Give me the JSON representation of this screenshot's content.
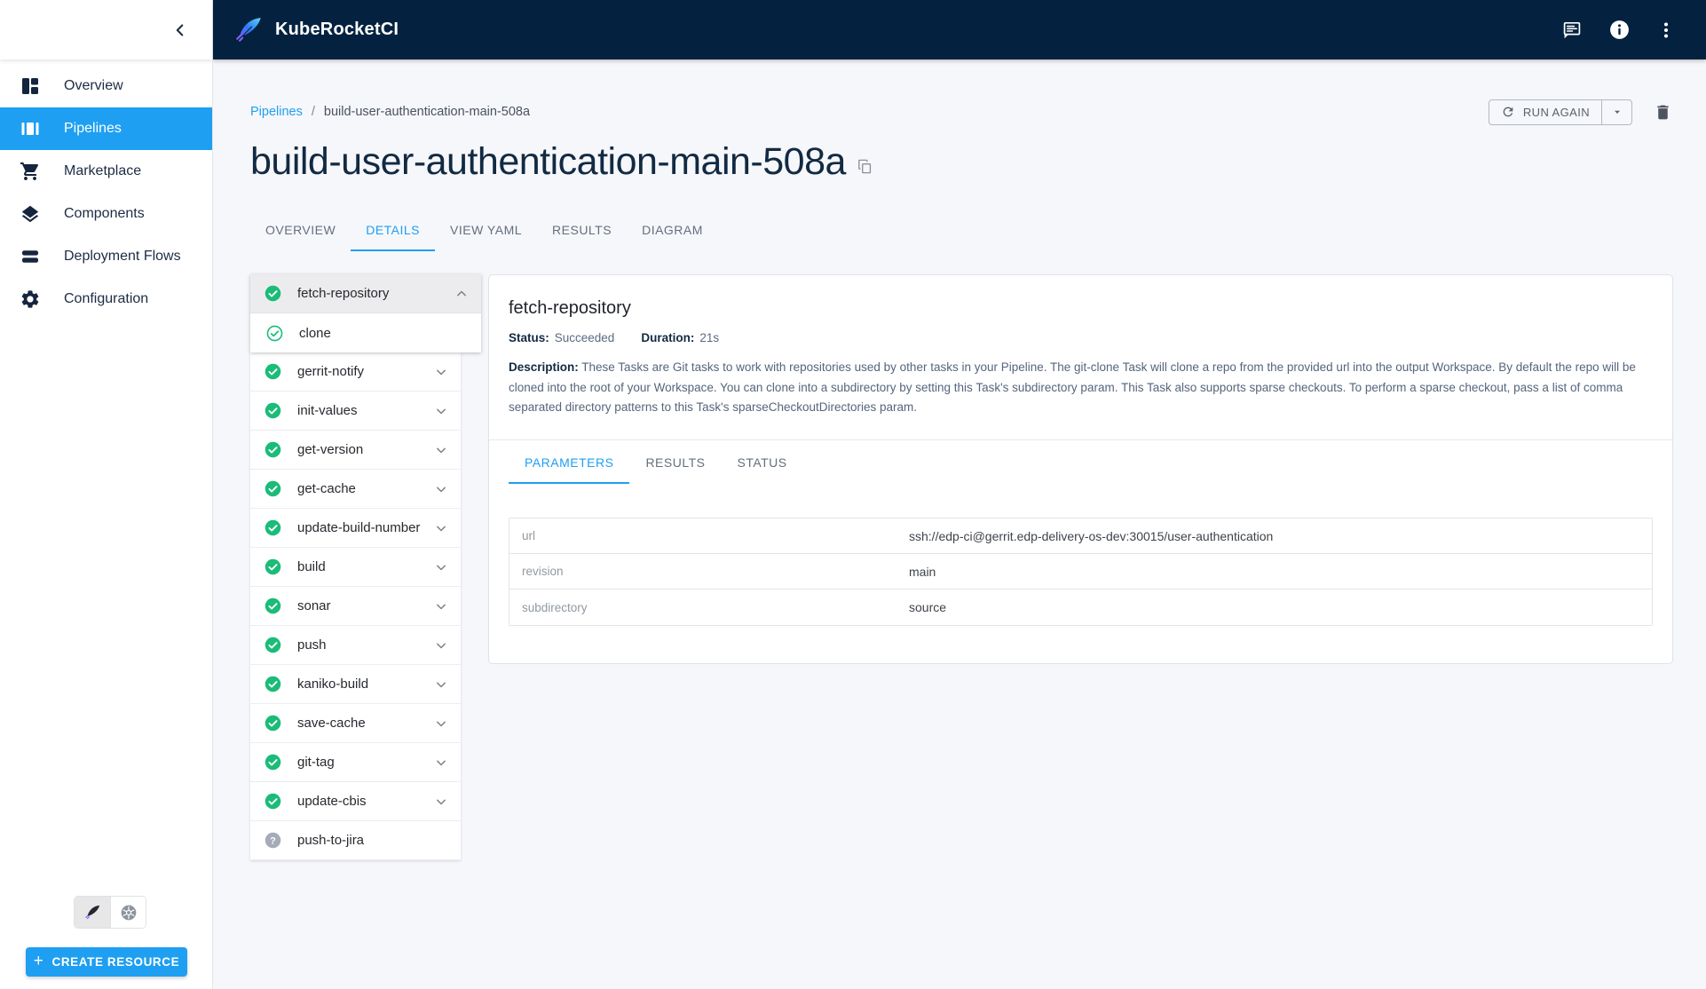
{
  "app": {
    "title": "KubeRocketCI"
  },
  "sidebar": {
    "items": [
      {
        "label": "Overview"
      },
      {
        "label": "Pipelines"
      },
      {
        "label": "Marketplace"
      },
      {
        "label": "Components"
      },
      {
        "label": "Deployment Flows"
      },
      {
        "label": "Configuration"
      }
    ],
    "create_button_label": "CREATE RESOURCE"
  },
  "breadcrumb": {
    "parent": "Pipelines",
    "separator": "/",
    "current": "build-user-authentication-main-508a"
  },
  "page": {
    "title": "build-user-authentication-main-508a"
  },
  "toolbar": {
    "run_again_label": "RUN AGAIN"
  },
  "tabs": [
    {
      "label": "OVERVIEW"
    },
    {
      "label": "DETAILS"
    },
    {
      "label": "VIEW YAML"
    },
    {
      "label": "RESULTS"
    },
    {
      "label": "DIAGRAM"
    }
  ],
  "tasks": [
    {
      "name": "fetch-repository",
      "status": "succeeded",
      "expanded": true,
      "steps": [
        {
          "name": "clone",
          "status": "succeeded"
        }
      ]
    },
    {
      "name": "gerrit-notify",
      "status": "succeeded"
    },
    {
      "name": "init-values",
      "status": "succeeded"
    },
    {
      "name": "get-version",
      "status": "succeeded"
    },
    {
      "name": "get-cache",
      "status": "succeeded"
    },
    {
      "name": "update-build-number",
      "status": "succeeded"
    },
    {
      "name": "build",
      "status": "succeeded"
    },
    {
      "name": "sonar",
      "status": "succeeded"
    },
    {
      "name": "push",
      "status": "succeeded"
    },
    {
      "name": "kaniko-build",
      "status": "succeeded"
    },
    {
      "name": "save-cache",
      "status": "succeeded"
    },
    {
      "name": "git-tag",
      "status": "succeeded"
    },
    {
      "name": "update-cbis",
      "status": "succeeded"
    },
    {
      "name": "push-to-jira",
      "status": "unknown"
    }
  ],
  "detail": {
    "title": "fetch-repository",
    "status_label": "Status:",
    "status_value": "Succeeded",
    "duration_label": "Duration:",
    "duration_value": "21s",
    "description_label": "Description:",
    "description_text": "These Tasks are Git tasks to work with repositories used by other tasks in your Pipeline. The git-clone Task will clone a repo from the provided url into the output Workspace. By default the repo will be cloned into the root of your Workspace. You can clone into a subdirectory by setting this Task's subdirectory param. This Task also supports sparse checkouts. To perform a sparse checkout, pass a list of comma separated directory patterns to this Task's sparseCheckoutDirectories param.",
    "tabs": [
      {
        "label": "PARAMETERS"
      },
      {
        "label": "RESULTS"
      },
      {
        "label": "STATUS"
      }
    ],
    "parameters": [
      {
        "key": "url",
        "value": "ssh://edp-ci@gerrit.edp-delivery-os-dev:30015/user-authentication"
      },
      {
        "key": "revision",
        "value": "main"
      },
      {
        "key": "subdirectory",
        "value": "source"
      }
    ]
  },
  "colors": {
    "accent_blue": "#1e9ff2",
    "header_navy": "#04223f",
    "success_green": "#1abc78",
    "unknown_grey": "#a5abb8"
  }
}
